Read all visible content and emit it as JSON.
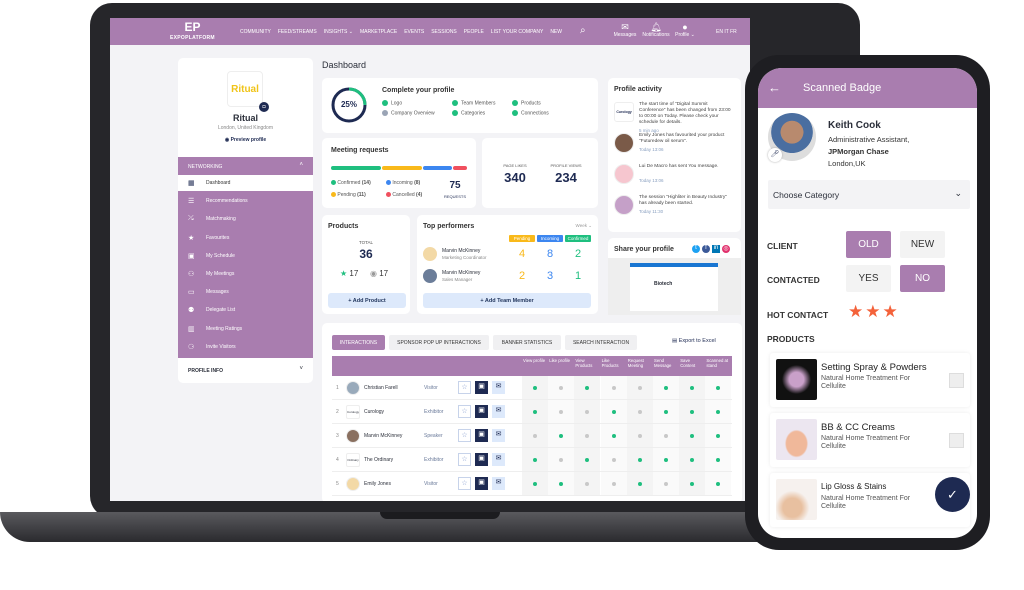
{
  "nav": {
    "logo": "EP",
    "logo_sub": "EXPOPLATFORM",
    "links": [
      "COMMUNITY",
      "FEED/STREAMS",
      "INSIGHTS ⌄",
      "MARKETPLACE",
      "EVENTS",
      "SESSIONS",
      "PEOPLE",
      "LIST YOUR COMPANY",
      "NEW"
    ],
    "messages": "Messages",
    "notifications": "Notifications",
    "profile": "Profile ⌄",
    "langs": "EN  IT  FR"
  },
  "sidebar": {
    "logo": "Ritual",
    "name": "Ritual",
    "location": "London, United Kingdom",
    "preview": "Preview profile",
    "section": "NETWORKING",
    "items": [
      {
        "label": "Dashboard",
        "icon": "dashboard-icon",
        "glyph": "▦"
      },
      {
        "label": "Recommendations",
        "icon": "list-icon",
        "glyph": "☰"
      },
      {
        "label": "Matchmaking",
        "icon": "matchmaking-icon",
        "glyph": "⤯"
      },
      {
        "label": "Favourites",
        "icon": "star-icon",
        "glyph": "★"
      },
      {
        "label": "My Schedule",
        "icon": "calendar-icon",
        "glyph": "▣"
      },
      {
        "label": "My Meetings",
        "icon": "meetings-icon",
        "glyph": "⚇"
      },
      {
        "label": "Messages",
        "icon": "message-icon",
        "glyph": "▭"
      },
      {
        "label": "Delegate List",
        "icon": "people-icon",
        "glyph": "⚉"
      },
      {
        "label": "Meeting Ratings",
        "icon": "ratings-icon",
        "glyph": "▥"
      },
      {
        "label": "Invite Visitors",
        "icon": "invite-icon",
        "glyph": "⚆"
      }
    ],
    "profile_info": "PROFILE INFO"
  },
  "dashboard": {
    "title": "Dashboard",
    "profile": {
      "percent": "25%",
      "progress": 25,
      "title": "Complete your profile",
      "items": [
        {
          "label": "Logo",
          "done": true
        },
        {
          "label": "Team Members",
          "done": true
        },
        {
          "label": "Products",
          "done": true
        },
        {
          "label": "Company Overview",
          "done": false
        },
        {
          "label": "Categories",
          "done": true
        },
        {
          "label": "Connections",
          "done": true
        }
      ]
    },
    "meetings": {
      "title": "Meeting requests",
      "confirmed": "Confirmed",
      "confirmed_n": "(14)",
      "incoming": "Incoming",
      "incoming_n": "(8)",
      "pending": "Pending",
      "pending_n": "(11)",
      "cancelled": "Cancelled",
      "cancelled_n": "(4)",
      "total": "75",
      "total_label": "REQUESTS",
      "values": [
        14,
        11,
        8,
        4
      ],
      "colors": [
        "#1fbf7f",
        "#f9b91a",
        "#3c86f0",
        "#f0505e"
      ]
    },
    "stats": {
      "likes_label": "PAGE LIKES",
      "likes": "340",
      "views_label": "PROFILE VIEWS",
      "views": "234"
    },
    "products": {
      "title": "Products",
      "total_label": "TOTAL",
      "total": "36",
      "stars": "17",
      "views": "17",
      "add": "+  Add Product"
    },
    "performers": {
      "title": "Top performers",
      "period": "Week ⌄",
      "cols": [
        "Pending",
        "Incoming",
        "Confirmed"
      ],
      "rows": [
        {
          "name": "Marvin McKinney",
          "role": "Marketing Coordinator",
          "v": [
            "4",
            "8",
            "2"
          ]
        },
        {
          "name": "Marvin McKinney",
          "role": "Sales Manager",
          "v": [
            "2",
            "3",
            "1"
          ]
        }
      ],
      "add": "+  Add Team Member"
    },
    "activity": {
      "title": "Profile activity",
      "items": [
        {
          "text": "The start time of \"Digital Summit Conference\" has been changed from 23:00 to 00:00 on Today. Please check your schedule for details.",
          "time": "5 min ago",
          "avatar": "Curology"
        },
        {
          "text": "Emily Jones has favourited your product \"Futuredew oil serum\".",
          "time": "Today 13:06",
          "avatar": ""
        },
        {
          "text": "Lui De Macro has sent You message.",
          "time": "Today 13:06",
          "avatar": ""
        },
        {
          "text": "The session \"Highliter in Beauty Industry\" has already been started.",
          "time": "Today 11:30",
          "avatar": ""
        }
      ]
    },
    "share": {
      "title": "Share your profile",
      "company": "Biotech"
    },
    "interactions": {
      "tabs": [
        "INTERACTIONS",
        "SPONSOR POP UP INTERACTIONS",
        "BANNER STATISTICS",
        "SEARCH INTERACTION"
      ],
      "export": "Export to Excel",
      "columns": [
        "View profile",
        "Like profile",
        "View Products",
        "Like Products",
        "Request Meeting",
        "Send Message",
        "Save Content",
        "Scanned at stand"
      ],
      "rows": [
        {
          "n": "1",
          "name": "Christian Farell",
          "type": "Visitor",
          "logo": "",
          "d": [
            1,
            0,
            1,
            0,
            0,
            1,
            1,
            1
          ]
        },
        {
          "n": "2",
          "name": "Curology",
          "type": "Exhibitor",
          "logo": "Curology",
          "d": [
            1,
            0,
            0,
            1,
            0,
            1,
            1,
            1
          ]
        },
        {
          "n": "3",
          "name": "Marvin McKinney",
          "type": "Speaker",
          "logo": "",
          "d": [
            0,
            1,
            0,
            1,
            0,
            0,
            1,
            1
          ]
        },
        {
          "n": "4",
          "name": "The Ordinary",
          "type": "Exhibitor",
          "logo": "Ordinary",
          "d": [
            1,
            0,
            1,
            0,
            1,
            1,
            1,
            1
          ]
        },
        {
          "n": "5",
          "name": "Emily Jones",
          "type": "Visitor",
          "logo": "",
          "d": [
            1,
            1,
            0,
            0,
            1,
            0,
            1,
            1
          ]
        }
      ]
    }
  },
  "phone": {
    "title": "Scanned Badge",
    "name": "Keith Cook",
    "role": "Administrative Assistant,",
    "company": "JPMorgan Chase",
    "location": "London,UK",
    "category": "Choose Category",
    "client": "CLIENT",
    "old": "OLD",
    "new": "NEW",
    "contacted": "CONTACTED",
    "yes": "YES",
    "no": "NO",
    "hot": "HOT CONTACT",
    "hot_rating": 3,
    "products_label": "PRODUCTS",
    "products": [
      {
        "title": "Setting Spray & Powders",
        "desc": "Natural Home Treatment For Cellulite"
      },
      {
        "title": "BB & CC Creams",
        "desc": "Natural Home Treatment For Cellulite"
      },
      {
        "title": "Lip Gloss & Stains",
        "desc": "Natural Home Treatment For Cellulite"
      }
    ]
  },
  "colors": {
    "brand": "#a97daf",
    "navy": "#1e2a52",
    "green": "#1fbf7f",
    "star": "#f4623a"
  }
}
